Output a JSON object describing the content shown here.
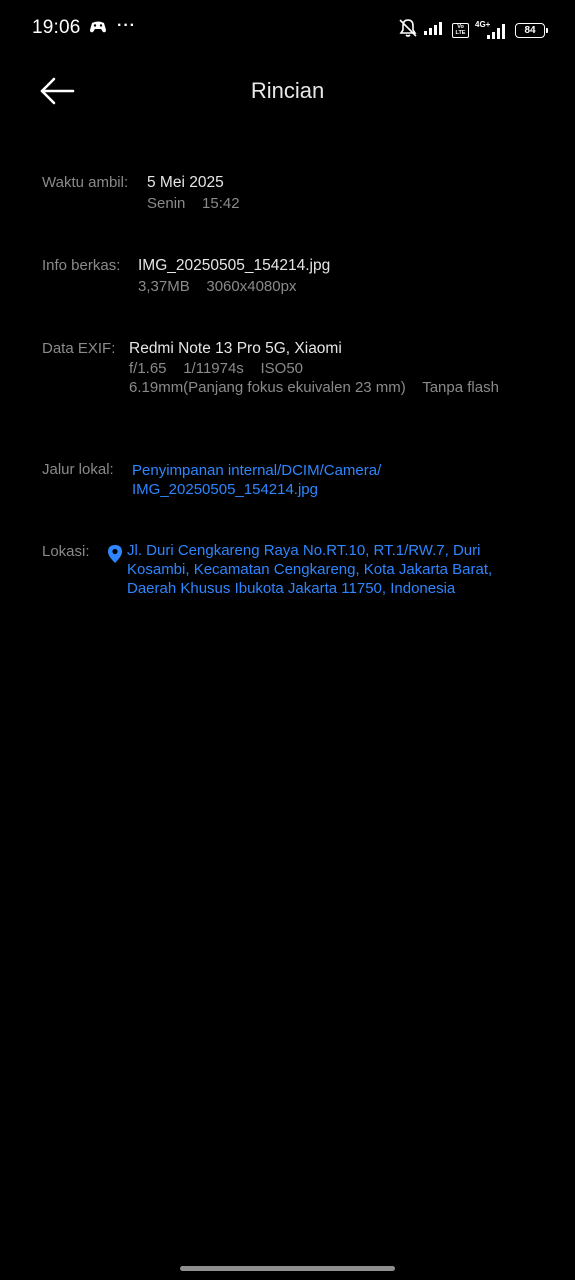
{
  "status_bar": {
    "time": "19:06",
    "battery": "84",
    "network": "4G+",
    "volte": "Vo LTE",
    "overflow": "···"
  },
  "header": {
    "title": "Rincian"
  },
  "details": {
    "taken_time": {
      "label": "Waktu ambil:",
      "date": "5 Mei 2025",
      "day_time": "Senin    15:42"
    },
    "file_info": {
      "label": "Info berkas:",
      "filename": "IMG_20250505_154214.jpg",
      "size_resolution": "3,37MB    3060x4080px"
    },
    "exif": {
      "label": "Data EXIF:",
      "device": "Redmi Note 13 Pro 5G, Xiaomi",
      "exposure": "f/1.65    1/11974s    ISO50",
      "focal_flash": "6.19mm(Panjang fokus ekuivalen 23 mm)    Tanpa flash"
    },
    "local_path": {
      "label": "Jalur lokal:",
      "line1": "Penyimpanan internal/DCIM/Camera/",
      "line2": "IMG_20250505_154214.jpg"
    },
    "location": {
      "label": "Lokasi:",
      "line1": "Jl. Duri Cengkareng Raya No.RT.10, RT.1/RW.7, Duri",
      "line2": "Kosambi, Kecamatan Cengkareng, Kota Jakarta Barat,",
      "line3": "Daerah Khusus Ibukota Jakarta 11750, Indonesia"
    }
  },
  "colors": {
    "background": "#000000",
    "link": "#2e86ff",
    "label": "#8a8a8a",
    "primary_text": "#e6e6e6"
  }
}
